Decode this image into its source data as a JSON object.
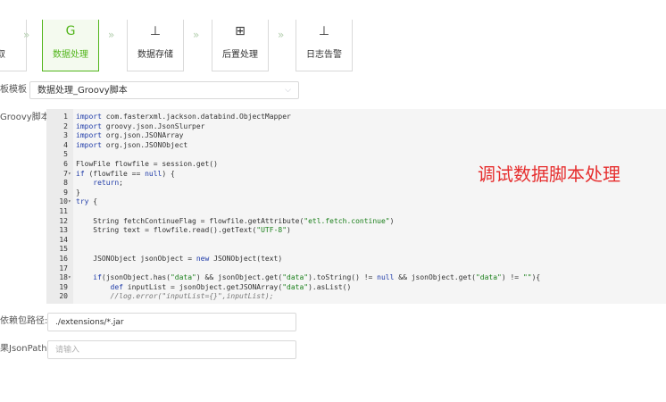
{
  "steps": [
    {
      "label": "取",
      "icon": "",
      "state": "partial"
    },
    {
      "label": "数据处理",
      "icon": "G",
      "state": "active"
    },
    {
      "label": "数据存储",
      "icon": "⊥",
      "state": "normal"
    },
    {
      "label": "后置处理",
      "icon": "⊞",
      "state": "normal"
    },
    {
      "label": "日志告警",
      "icon": "⊥",
      "state": "normal"
    }
  ],
  "step_arrow": "»",
  "template": {
    "label": "板模板",
    "value": "数据处理_Groovy脚本",
    "chevron": "⌵"
  },
  "script": {
    "label": "Groovy脚本",
    "lines": [
      {
        "n": "1",
        "fold": "",
        "html": "<span class=\"kw\">import</span> com.fasterxml.jackson.databind.ObjectMapper"
      },
      {
        "n": "2",
        "fold": "",
        "html": "<span class=\"kw\">import</span> groovy.json.JsonSlurper"
      },
      {
        "n": "3",
        "fold": "",
        "html": "<span class=\"kw\">import</span> org.json.JSONArray"
      },
      {
        "n": "4",
        "fold": "",
        "html": "<span class=\"kw\">import</span> org.json.JSONObject"
      },
      {
        "n": "5",
        "fold": "",
        "html": ""
      },
      {
        "n": "6",
        "fold": "",
        "html": "FlowFile flowfile = session.get()"
      },
      {
        "n": "7",
        "fold": "▾",
        "html": "<span class=\"kw\">if</span> (flowfile == <span class=\"lit\">null</span>) {"
      },
      {
        "n": "8",
        "fold": "",
        "html": "    <span class=\"kw\">return</span>;"
      },
      {
        "n": "9",
        "fold": "",
        "html": "}"
      },
      {
        "n": "10",
        "fold": "▾",
        "html": "<span class=\"kw\">try</span> {"
      },
      {
        "n": "11",
        "fold": "",
        "html": ""
      },
      {
        "n": "12",
        "fold": "",
        "html": "    String fetchContinueFlag = flowfile.getAttribute(<span class=\"str\">\"etl.fetch.continue\"</span>)"
      },
      {
        "n": "13",
        "fold": "",
        "html": "    String text = flowfile.read().getText(<span class=\"str\">\"UTF-8\"</span>)"
      },
      {
        "n": "14",
        "fold": "",
        "html": ""
      },
      {
        "n": "15",
        "fold": "",
        "html": ""
      },
      {
        "n": "16",
        "fold": "",
        "html": "    JSONObject jsonObject = <span class=\"kw\">new</span> JSONObject(text)"
      },
      {
        "n": "17",
        "fold": "",
        "html": ""
      },
      {
        "n": "18",
        "fold": "▾",
        "html": "    <span class=\"kw\">if</span>(jsonObject.has(<span class=\"str\">\"data\"</span>) &amp;&amp; jsonObject.get(<span class=\"str\">\"data\"</span>).toString() != <span class=\"lit\">null</span> &amp;&amp; jsonObject.get(<span class=\"str\">\"data\"</span>) != <span class=\"str\">\"\"</span>){"
      },
      {
        "n": "19",
        "fold": "",
        "html": "        <span class=\"kw\">def</span> inputList = jsonObject.getJSONArray(<span class=\"str\">\"data\"</span>).asList()"
      },
      {
        "n": "20",
        "fold": "",
        "html": "        <span class=\"cm\">//log.error(\"inputList={}\",inputList);</span>"
      }
    ]
  },
  "overlay_text": "调试数据脚本处理",
  "dependency": {
    "label": "依赖包路径:",
    "value": "./extensions/*.jar"
  },
  "jsonpath": {
    "label": "果JsonPath:",
    "placeholder": "请输入"
  }
}
